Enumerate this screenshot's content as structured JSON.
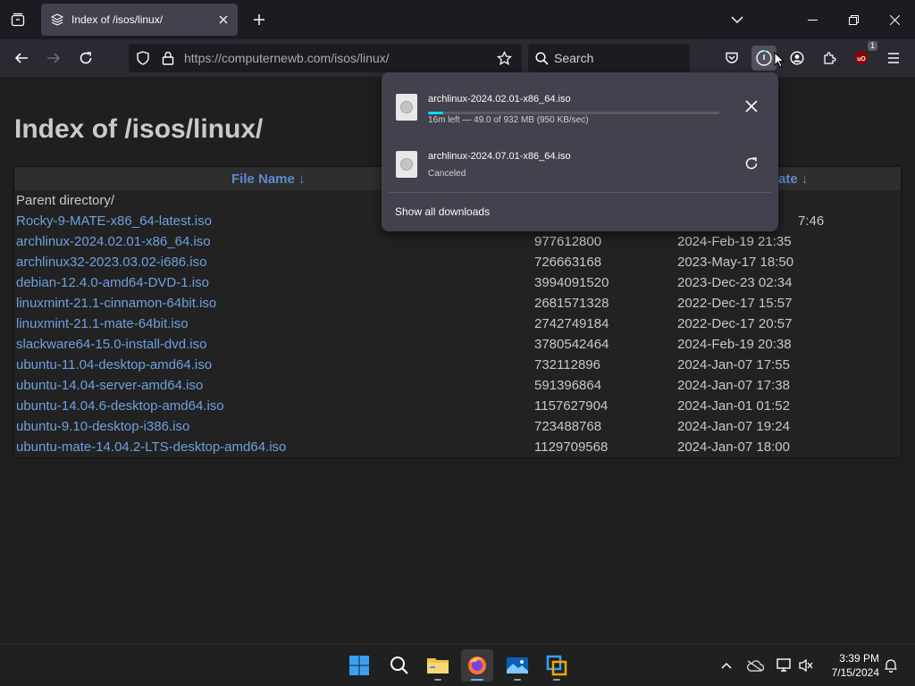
{
  "browser": {
    "tab_title": "Index of /isos/linux/",
    "url_host": "https://computernewb.com",
    "url_path": "/isos/linux/",
    "search_placeholder": "Search",
    "extension_badge": "1"
  },
  "page": {
    "heading": "Index of /isos/linux/",
    "headers": {
      "name": "File Name  ↓",
      "date": "ate  ↓",
      "date_row1_suffix": "7:46"
    },
    "parent": "Parent directory/",
    "files": [
      {
        "name": "Rocky-9-MATE-x86_64-latest.iso",
        "size": "",
        "date": ""
      },
      {
        "name": "archlinux-2024.02.01-x86_64.iso",
        "size": "977612800",
        "date": "2024-Feb-19 21:35"
      },
      {
        "name": "archlinux32-2023.03.02-i686.iso",
        "size": "726663168",
        "date": "2023-May-17 18:50"
      },
      {
        "name": "debian-12.4.0-amd64-DVD-1.iso",
        "size": "3994091520",
        "date": "2023-Dec-23 02:34"
      },
      {
        "name": "linuxmint-21.1-cinnamon-64bit.iso",
        "size": "2681571328",
        "date": "2022-Dec-17 15:57"
      },
      {
        "name": "linuxmint-21.1-mate-64bit.iso",
        "size": "2742749184",
        "date": "2022-Dec-17 20:57"
      },
      {
        "name": "slackware64-15.0-install-dvd.iso",
        "size": "3780542464",
        "date": "2024-Feb-19 20:38"
      },
      {
        "name": "ubuntu-11.04-desktop-amd64.iso",
        "size": "732112896",
        "date": "2024-Jan-07 17:55"
      },
      {
        "name": "ubuntu-14.04-server-amd64.iso",
        "size": "591396864",
        "date": "2024-Jan-07 17:38"
      },
      {
        "name": "ubuntu-14.04.6-desktop-amd64.iso",
        "size": "1157627904",
        "date": "2024-Jan-01 01:52"
      },
      {
        "name": "ubuntu-9.10-desktop-i386.iso",
        "size": "723488768",
        "date": "2024-Jan-07 19:24"
      },
      {
        "name": "ubuntu-mate-14.04.2-LTS-desktop-amd64.iso",
        "size": "1129709568",
        "date": "2024-Jan-07 18:00"
      }
    ]
  },
  "downloads": {
    "items": [
      {
        "name": "archlinux-2024.02.01-x86_64.iso",
        "status": "16m left — 49.0 of 932 MB (950 KB/sec)",
        "progress": 0.053
      },
      {
        "name": "archlinux-2024.07.01-x86_64.iso",
        "status": "Canceled"
      }
    ],
    "show_all": "Show all downloads"
  },
  "taskbar": {
    "time": "3:39 PM",
    "date": "7/15/2024"
  }
}
